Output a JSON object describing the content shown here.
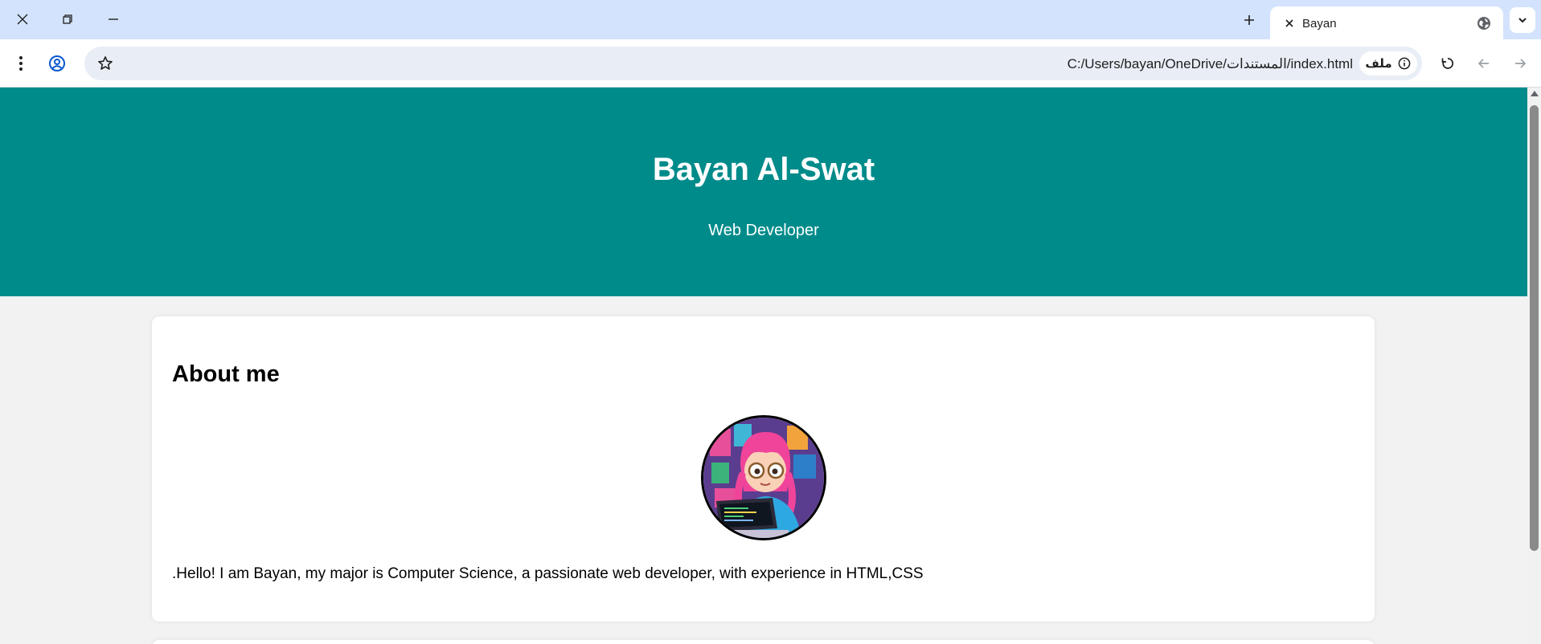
{
  "tab": {
    "title": "Bayan"
  },
  "address": {
    "scheme_label": "ملف",
    "url": "C:/Users/bayan/OneDrive/المستندات/index.html"
  },
  "icons": {
    "window_close": "close-icon",
    "window_restore": "restore-icon",
    "window_minimize": "minimize-icon",
    "new_tab": "plus-icon",
    "tab_close": "close-icon",
    "tab_favicon": "globe-icon",
    "tab_search": "chevron-down-icon",
    "menu": "more-vert-icon",
    "profile": "profile-icon",
    "bookmark": "star-icon",
    "site_info": "info-icon",
    "reload": "reload-icon",
    "back": "arrow-back-icon",
    "forward": "arrow-forward-icon"
  },
  "page": {
    "header": {
      "name": "Bayan Al-Swat",
      "role": "Web Developer"
    },
    "about": {
      "title": "About me",
      "text": ".Hello! I am Bayan, my major is Computer Science, a passionate web developer, with experience in HTML,CSS"
    }
  },
  "colors": {
    "header_bg": "#008b8b",
    "tabstrip_bg": "#d3e3fd",
    "page_bg": "#f2f2f2",
    "omnibox_bg": "#e9eef6"
  }
}
